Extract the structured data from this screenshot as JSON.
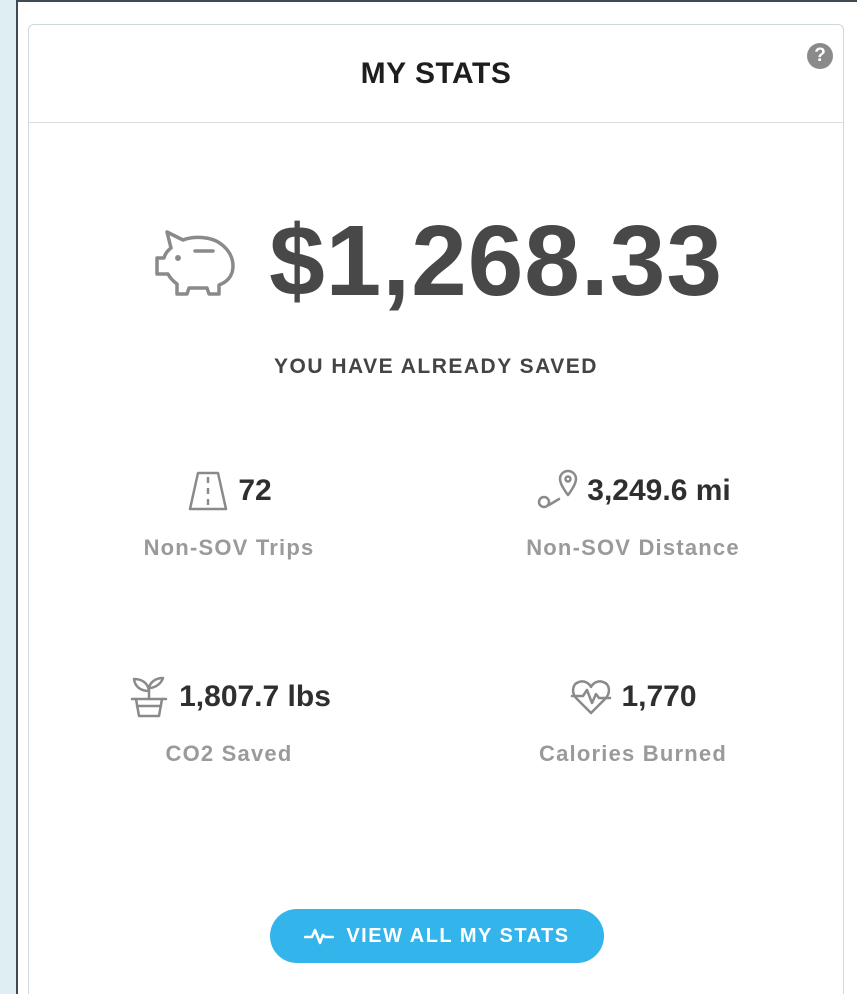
{
  "widget": {
    "title": "MY STATS",
    "help_icon": "question-circle-icon"
  },
  "savings": {
    "amount": "$1,268.33",
    "label": "YOU HAVE ALREADY SAVED",
    "icon": "piggy-bank-icon"
  },
  "stats": [
    {
      "value": "72",
      "label": "Non-SOV Trips",
      "icon": "road-icon"
    },
    {
      "value": "3,249.6 mi",
      "label": "Non-SOV Distance",
      "icon": "route-pin-icon"
    },
    {
      "value": "1,807.7 lbs",
      "label": "CO2 Saved",
      "icon": "plant-pot-icon"
    },
    {
      "value": "1,770",
      "label": "Calories Burned",
      "icon": "heart-pulse-icon"
    }
  ],
  "button": {
    "label": "VIEW ALL MY STATS",
    "icon": "activity-pulse-icon"
  },
  "colors": {
    "accent": "#33b5ec",
    "amount": "#484848",
    "label_muted": "#9a9a9a",
    "icon_gray": "#8a8a8a"
  }
}
